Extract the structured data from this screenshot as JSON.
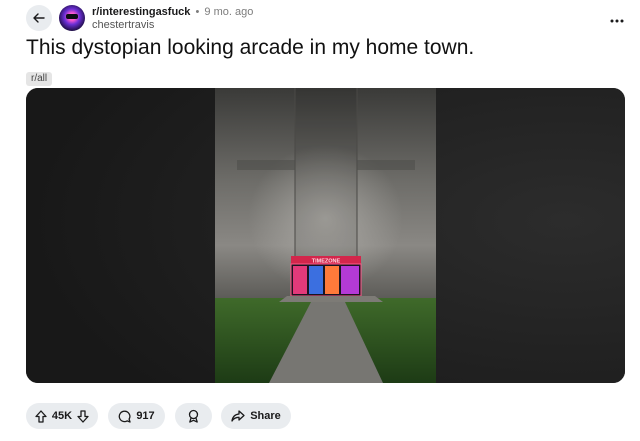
{
  "post": {
    "subreddit": "r/interestingasfuck",
    "separator": "•",
    "age": "9 mo. ago",
    "author": "chestertravis",
    "title": "This dystopian looking arcade in my home town.",
    "flair": "r/all",
    "storefront_sign": "TIMEZONE"
  },
  "actions": {
    "upvotes": "45K",
    "comments": "917",
    "share_label": "Share"
  },
  "icons": {
    "back": "back-arrow-icon",
    "more": "more-options-icon",
    "upvote": "upvote-arrow-icon",
    "downvote": "downvote-arrow-icon",
    "comment": "comment-bubble-icon",
    "award": "award-icon",
    "share": "share-arrow-icon"
  },
  "colors": {
    "pill_bg": "#e9ecef",
    "text": "#1a1a1b",
    "muted": "#7c7c7c"
  }
}
